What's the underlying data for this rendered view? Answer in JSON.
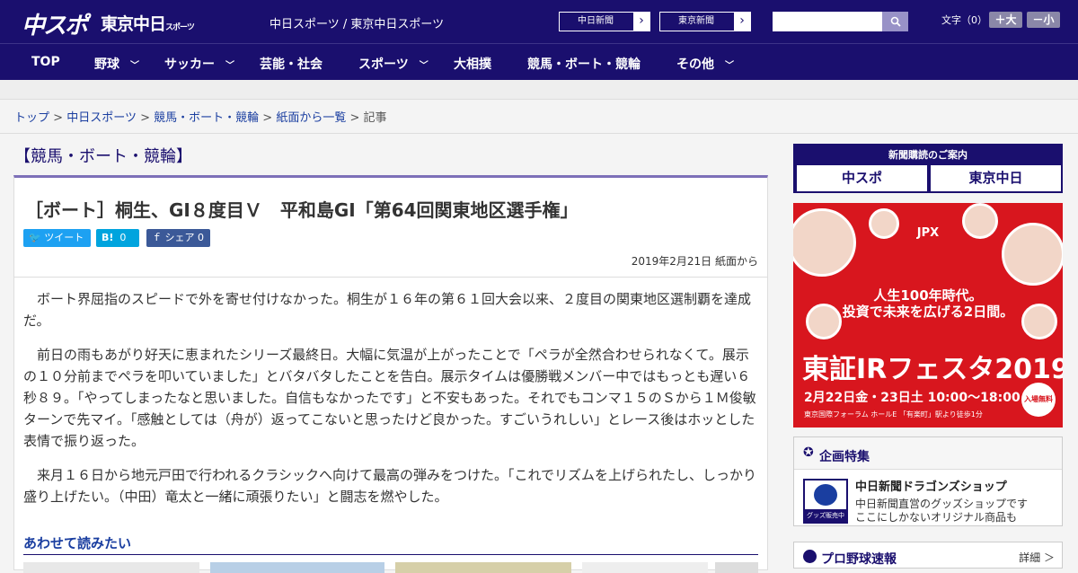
{
  "header": {
    "logo_main": "中スポ",
    "logo_tokyo": "東京中日",
    "logo_tokyo_sub": "スポーツ",
    "tagline": "中日スポーツ / 東京中日スポーツ",
    "paper_buttons": [
      "中日新聞",
      "東京新聞"
    ],
    "font_size_label": "文字（0）",
    "font_up": "＋大",
    "font_down": "－小"
  },
  "nav": {
    "items": [
      {
        "label": "TOP",
        "dropdown": false
      },
      {
        "label": "野球",
        "dropdown": true
      },
      {
        "label": "サッカー",
        "dropdown": true
      },
      {
        "label": "芸能・社会",
        "dropdown": false
      },
      {
        "label": "スポーツ",
        "dropdown": true
      },
      {
        "label": "大相撲",
        "dropdown": false
      },
      {
        "label": "競馬・ボート・競輪",
        "dropdown": false
      },
      {
        "label": "その他",
        "dropdown": true
      }
    ]
  },
  "breadcrumb": {
    "items": [
      "トップ",
      "中日スポーツ",
      "競馬・ボート・競輪",
      "紙面から一覧"
    ],
    "current": "記事",
    "separator": ">"
  },
  "article": {
    "section": "【競馬・ボート・競輪】",
    "headline": "［ボート］桐生、GI８度目Ｖ　平和島GI「第64回関東地区選手権」",
    "share": {
      "tweet": "ツイート",
      "hatena": "B!",
      "hatena_count": "0",
      "fb": "シェア",
      "fb_count": "0"
    },
    "date": "2019年2月21日 紙面から",
    "paragraphs": [
      "ボート界屈指のスピードで外を寄せ付けなかった。桐生が１６年の第６１回大会以来、２度目の関東地区選制覇を達成だ。",
      "前日の雨もあがり好天に恵まれたシリーズ最終日。大幅に気温が上がったことで「ペラが全然合わせられなくて。展示の１０分前までペラを叩いていました」とバタバタしたことを告白。展示タイムは優勝戦メンバー中ではもっとも遅い６秒８９。「やってしまったなと思いました。自信もなかったです」と不安もあった。それでもコンマ１５のＳから１Ｍ俊敏ターンで先マイ。「感触としては（舟が）返ってこないと思ったけど良かった。すごいうれしい」とレース後はホッとした表情で振り返った。",
      "来月１６日から地元戸田で行われるクラシックへ向けて最高の弾みをつけた。「これでリズムを上げられたし、しっかり盛り上げたい。（中田）竜太と一緒に頑張りたい」と闘志を燃やした。"
    ],
    "related_title": "あわせて読みたい"
  },
  "sidebar": {
    "subscribe": {
      "title": "新聞購読のご案内",
      "brands": [
        "中スポ",
        "東京中日"
      ]
    },
    "ad": {
      "org": "JPX",
      "line1": "人生100年時代。",
      "line2": "投資で未来を広げる2日間。",
      "event": "東証IRフェスタ2019",
      "dates": "2月22日金・23日土 10:00～18:00",
      "venue": "東京国際フォーラム ホールE 「有楽町」駅より徒歩1分",
      "free": "入場無料"
    },
    "feature": {
      "title": "企画特集",
      "shop_name": "中日新聞ドラゴンズショップ",
      "desc1": "中日新聞直営のグッズショップです",
      "desc2": "ここにしかないオリジナル商品も",
      "badge": "グッズ販売中"
    },
    "score": {
      "title": "プロ野球速報",
      "more": "詳細 ＞"
    }
  },
  "colors": {
    "brand_navy": "#1a0f6e",
    "link_blue": "#1a3ea0",
    "ad_red": "#d8161e",
    "twitter": "#1da1f2",
    "hatena": "#00a4de",
    "facebook": "#3b5998"
  }
}
